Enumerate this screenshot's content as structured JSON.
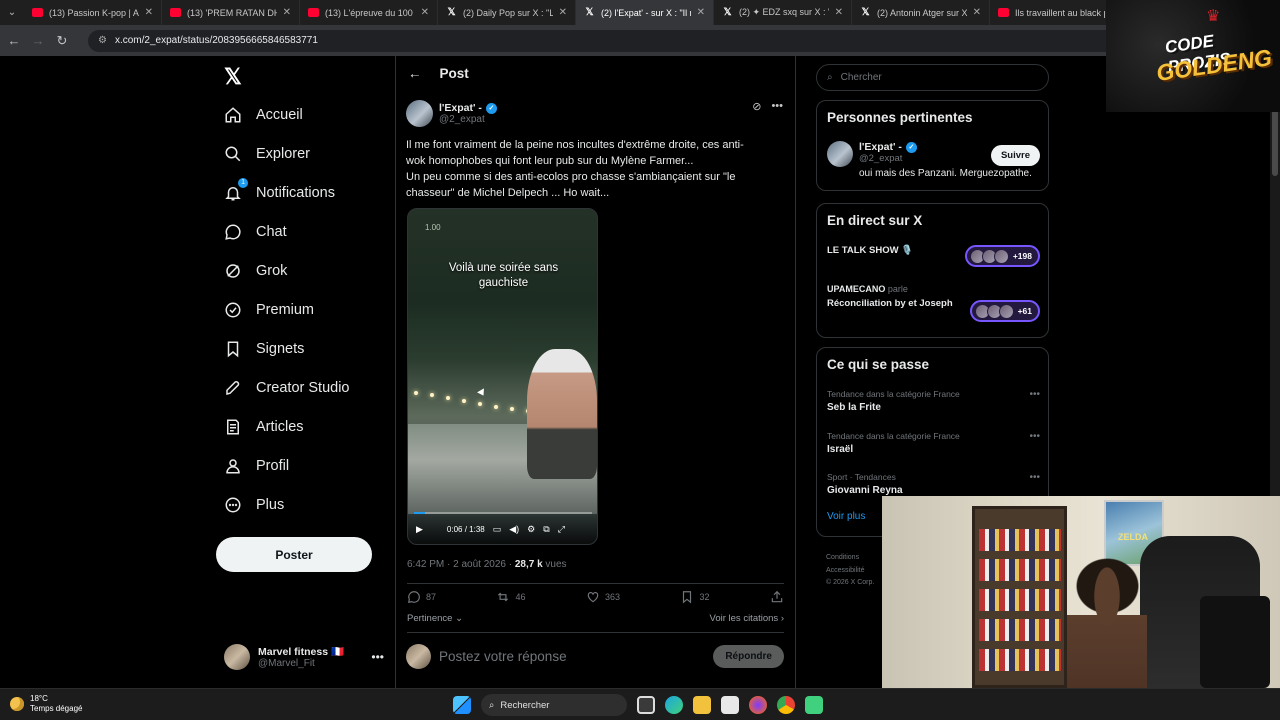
{
  "browser": {
    "tabs": [
      {
        "label": "(13) Passion K-pop | ARTE",
        "kind": "yt"
      },
      {
        "label": "(13) 'PREM RATAN DHAN",
        "kind": "yt"
      },
      {
        "label": "(13) L'épreuve du 100 mè",
        "kind": "yt"
      },
      {
        "label": "(2) Daily Pop sur X : \"Le t",
        "kind": "x"
      },
      {
        "label": "(2) l'Expat' - sur X : \"Il me",
        "kind": "x",
        "active": true
      },
      {
        "label": "(2) ✦ EDZ sxq sur X : \"Pers",
        "kind": "x"
      },
      {
        "label": "(2) Antonin Atger sur X : \"",
        "kind": "x"
      },
      {
        "label": "Ils travaillent au black po",
        "kind": "yt"
      }
    ],
    "url": "x.com/2_expat/status/2083956665846583771"
  },
  "nav": {
    "items": [
      {
        "label": "Accueil",
        "icon": "home-icon"
      },
      {
        "label": "Explorer",
        "icon": "search-icon"
      },
      {
        "label": "Notifications",
        "icon": "bell-icon",
        "badge": "1"
      },
      {
        "label": "Chat",
        "icon": "chat-icon"
      },
      {
        "label": "Grok",
        "icon": "grok-icon"
      },
      {
        "label": "Premium",
        "icon": "premium-icon"
      },
      {
        "label": "Signets",
        "icon": "bookmark-icon"
      },
      {
        "label": "Creator Studio",
        "icon": "rocket-icon"
      },
      {
        "label": "Articles",
        "icon": "articles-icon"
      },
      {
        "label": "Profil",
        "icon": "profile-icon"
      },
      {
        "label": "Plus",
        "icon": "more-icon"
      }
    ],
    "post_button": "Poster",
    "account": {
      "name": "Marvel fitness 🇫🇷",
      "handle": "@Marvel_Fit"
    }
  },
  "post": {
    "header": "Post",
    "author_name": "l'Expat' -",
    "author_handle": "@2_expat",
    "text_lines": [
      "Il me font vraiment de la peine nos incultes d'extrême droite, ces anti-",
      "wok homophobes qui font leur pub sur du Mylène Farmer...",
      "Un peu comme si des anti-ecolos pro chasse s'ambiançaient sur \"le",
      "chasseur\" de Michel Delpech ... Ho wait..."
    ],
    "video": {
      "corner_value": "1.00",
      "caption_line1": "Voilà une soirée sans",
      "caption_line2": "gauchiste",
      "time": "0:06 / 1:38",
      "progress": 0.06
    },
    "timestamp": "6:42 PM · 2 août 2026 · ",
    "views_count": "28,7 k",
    "views_label": " vues",
    "stats": {
      "replies": "87",
      "reposts": "46",
      "likes": "363",
      "bookmarks": "32"
    },
    "sort_label": "Pertinence",
    "quotes_link": "Voir les citations",
    "reply_placeholder": "Postez votre réponse",
    "reply_button": "Répondre"
  },
  "right": {
    "search_placeholder": "Chercher",
    "relevant": {
      "title": "Personnes pertinentes",
      "name": "l'Expat' -",
      "handle": "@2_expat",
      "bio": "oui mais des Panzani. Merguezopathe.",
      "follow": "Suivre"
    },
    "live": {
      "title": "En direct sur X",
      "items": [
        {
          "title": "LE TALK SHOW 🎙️",
          "host": "",
          "count": "+198"
        },
        {
          "title": "Réconciliation by et Joseph",
          "host": "UPAMECANO",
          "host_suffix": " parle",
          "count": "+61"
        }
      ]
    },
    "happening": {
      "title": "Ce qui se passe",
      "trends": [
        {
          "context": "Tendance dans la catégorie France",
          "name": "Seb la Frite"
        },
        {
          "context": "Tendance dans la catégorie France",
          "name": "Israël"
        },
        {
          "context": "Sport · Tendances",
          "name": "Giovanni Reyna"
        }
      ],
      "see_more": "Voir plus"
    },
    "footer": {
      "line1": "Conditions",
      "line2": "Accessibilité",
      "line3": "© 2026 X Corp."
    }
  },
  "overlay": {
    "line1": "CODE PROZIS",
    "line2": "GOLDENG"
  },
  "taskbar": {
    "temp": "18°C",
    "weather": "Temps dégagé",
    "search": "Rechercher"
  },
  "colors": {
    "accent": "#1d9bf0",
    "background": "#000000",
    "live_border": "#7856ff",
    "youtube": "#ff0033"
  }
}
